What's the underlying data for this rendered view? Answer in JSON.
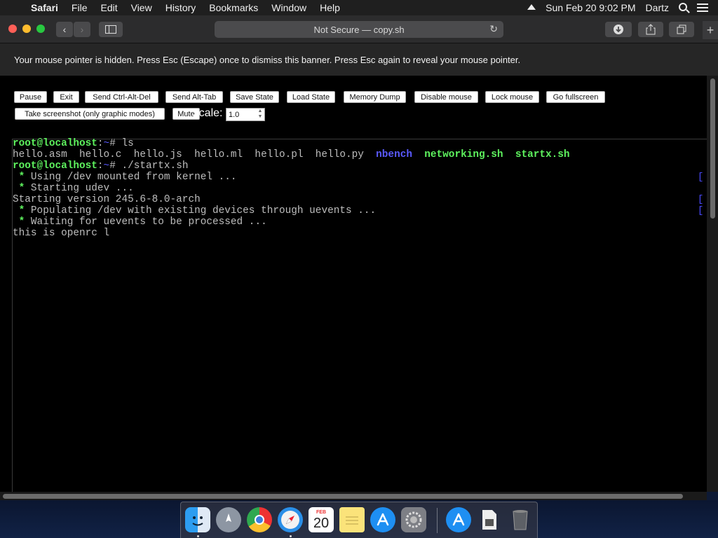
{
  "menubar": {
    "app": "Safari",
    "items": [
      "File",
      "Edit",
      "View",
      "History",
      "Bookmarks",
      "Window",
      "Help"
    ],
    "datetime": "Sun Feb 20  9:02 PM",
    "user": "Dartz"
  },
  "toolbar": {
    "address": "Not Secure — copy.sh",
    "new_tab": "+"
  },
  "banner": {
    "text": "Your mouse pointer is hidden. Press Esc (Escape) once to dismiss this banner. Press Esc again to reveal your mouse pointer."
  },
  "controls": {
    "pause": "Pause",
    "exit": "Exit",
    "ctrl_alt_del": "Send Ctrl-Alt-Del",
    "alt_tab": "Send Alt-Tab",
    "save_state": "Save State",
    "load_state": "Load State",
    "memory_dump": "Memory Dump",
    "disable_mouse": "Disable mouse",
    "lock_mouse": "Lock mouse",
    "fullscreen": "Go fullscreen",
    "screenshot": "Take screenshot (only graphic modes)",
    "mute": "Mute",
    "scale_label": "Scale:",
    "scale_value": "1.0"
  },
  "terminal": {
    "prompt": "root@localhost",
    "prompt_sep": ":",
    "cwd": "~",
    "prompt_end": "# ",
    "cmd1": "ls",
    "files_plain": "hello.asm  hello.c  hello.js  hello.ml  hello.pl  hello.py  ",
    "file_dir": "nbench",
    "file_exec1": "networking.sh",
    "file_exec2": "startx.sh",
    "cmd2": "./startx.sh",
    "line_udev_mount": "Using /dev mounted from kernel ...",
    "line_udev_start": "Starting udev ...",
    "line_version": "Starting version 245.6-8.0-arch",
    "line_populate": "Populating /dev with existing devices through uevents ...",
    "line_wait": "Waiting for uevents to be processed ...",
    "line_openrc": "this is openrc l",
    "bullet": " * ",
    "bracket": "["
  },
  "dock": {
    "calendar_month": "FEB",
    "calendar_day": "20"
  },
  "colors": {
    "prompt_green": "#5ef25e",
    "dir_blue": "#5a5aff",
    "terminal_text": "#bdbdbd"
  }
}
